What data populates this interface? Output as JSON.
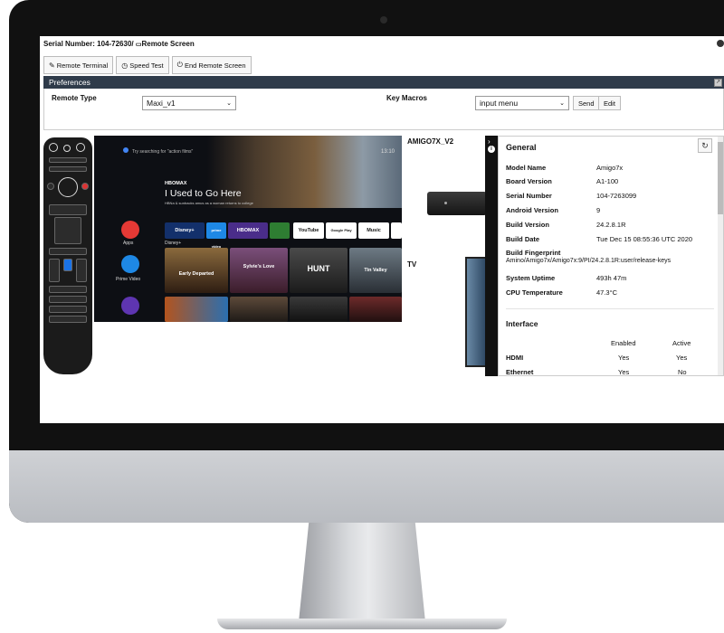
{
  "header": {
    "serial_label": "Serial Number: 104-72630/",
    "screen_label": "Remote Screen"
  },
  "toolbar": {
    "remote_terminal": "Remote Terminal",
    "speed_test": "Speed Test",
    "end_remote_screen": "End Remote Screen"
  },
  "preferences": {
    "title": "Preferences",
    "remote_type_label": "Remote Type",
    "remote_type_value": "Maxi_v1",
    "key_macros_label": "Key Macros",
    "key_macros_value": "input menu",
    "send": "Send",
    "edit": "Edit"
  },
  "tv_screen": {
    "search_hint": "Try searching for \"action films\"",
    "time": "13:10",
    "brand": "HBOMAX",
    "title": "I Used to Go Here",
    "description": "HBNa & sunbacks amus as a woman returns to college",
    "apps_label": "Apps",
    "prime_label": "Prime Video",
    "disney_label": "Disney+",
    "tiles": [
      "Disney+",
      "prime video",
      "HBOMAX",
      "",
      "YouTube",
      "Google Play",
      "Music"
    ],
    "posters": [
      "Early Departed",
      "Sylvie's Love",
      "HUNT",
      "Tin Valley"
    ]
  },
  "devices": {
    "device_name": "AMIGO7X_V2",
    "tv_name": "TV"
  },
  "info": {
    "general_title": "General",
    "rows": [
      {
        "key": "Model Name",
        "value": "Amigo7x"
      },
      {
        "key": "Board Version",
        "value": "A1-100"
      },
      {
        "key": "Serial Number",
        "value": "104-7263099"
      },
      {
        "key": "Android Version",
        "value": "9"
      },
      {
        "key": "Build Version",
        "value": "24.2.8.1R"
      },
      {
        "key": "Build Date",
        "value": "Tue Dec 15 08:55:36 UTC 2020"
      }
    ],
    "fingerprint_key": "Build Fingerprint",
    "fingerprint_value": "Amino/Amigo7x/Amigo7x:9/PI/24.2.8.1R:user/release-keys",
    "uptime_key": "System Uptime",
    "uptime_value": "493h 47m",
    "cpu_key": "CPU Temperature",
    "cpu_value": "47.3°C",
    "interface_title": "Interface",
    "col_enabled": "Enabled",
    "col_active": "Active",
    "interfaces": [
      {
        "name": "HDMI",
        "enabled": "Yes",
        "active": "Yes"
      },
      {
        "name": "Ethernet",
        "enabled": "Yes",
        "active": "No"
      }
    ]
  },
  "colors": {
    "prefs_bar": "#2f3b4a",
    "monitor_bezel": "#111111",
    "chin": "#c4c6ca"
  }
}
